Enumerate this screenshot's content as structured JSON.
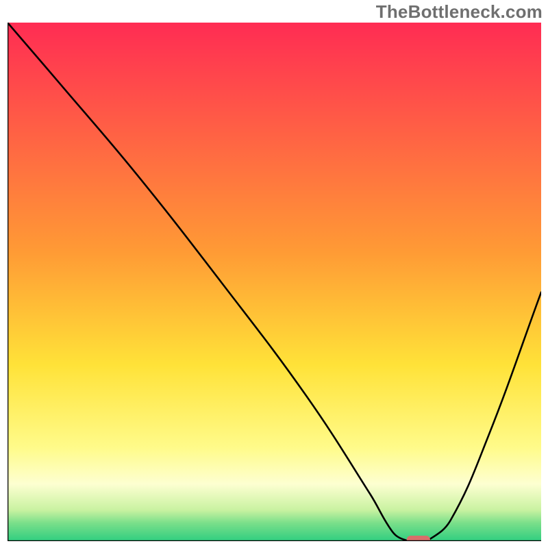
{
  "watermark": "TheBottleneck.com",
  "chart_data": {
    "type": "line",
    "title": "",
    "xlabel": "",
    "ylabel": "",
    "xlim": [
      0,
      100
    ],
    "ylim": [
      0,
      100
    ],
    "grid": false,
    "legend": false,
    "background_gradient": {
      "stops": [
        {
          "y": 0,
          "color": "#ff2c53"
        },
        {
          "y": 44,
          "color": "#ff9a35"
        },
        {
          "y": 66,
          "color": "#ffe238"
        },
        {
          "y": 82,
          "color": "#fffb8a"
        },
        {
          "y": 89,
          "color": "#fdffd1"
        },
        {
          "y": 94,
          "color": "#c9f2a1"
        },
        {
          "y": 96.5,
          "color": "#7adf8a"
        },
        {
          "y": 100,
          "color": "#2fce80"
        }
      ]
    },
    "series": [
      {
        "name": "bottleneck-curve",
        "color": "#000000",
        "x": [
          0,
          10,
          24,
          40,
          56,
          68,
          72,
          74,
          77,
          79,
          83,
          90,
          100
        ],
        "y": [
          100,
          88,
          71,
          50,
          28,
          9,
          2,
          0.4,
          0,
          0.3,
          4,
          20,
          48
        ]
      }
    ],
    "marker": {
      "name": "optimal-point",
      "x_center": 77,
      "x_half_width": 2.2,
      "y": 0,
      "color": "#d86f6a"
    }
  },
  "axes": {
    "stroke": "#000000",
    "stroke_width": 2.6
  }
}
